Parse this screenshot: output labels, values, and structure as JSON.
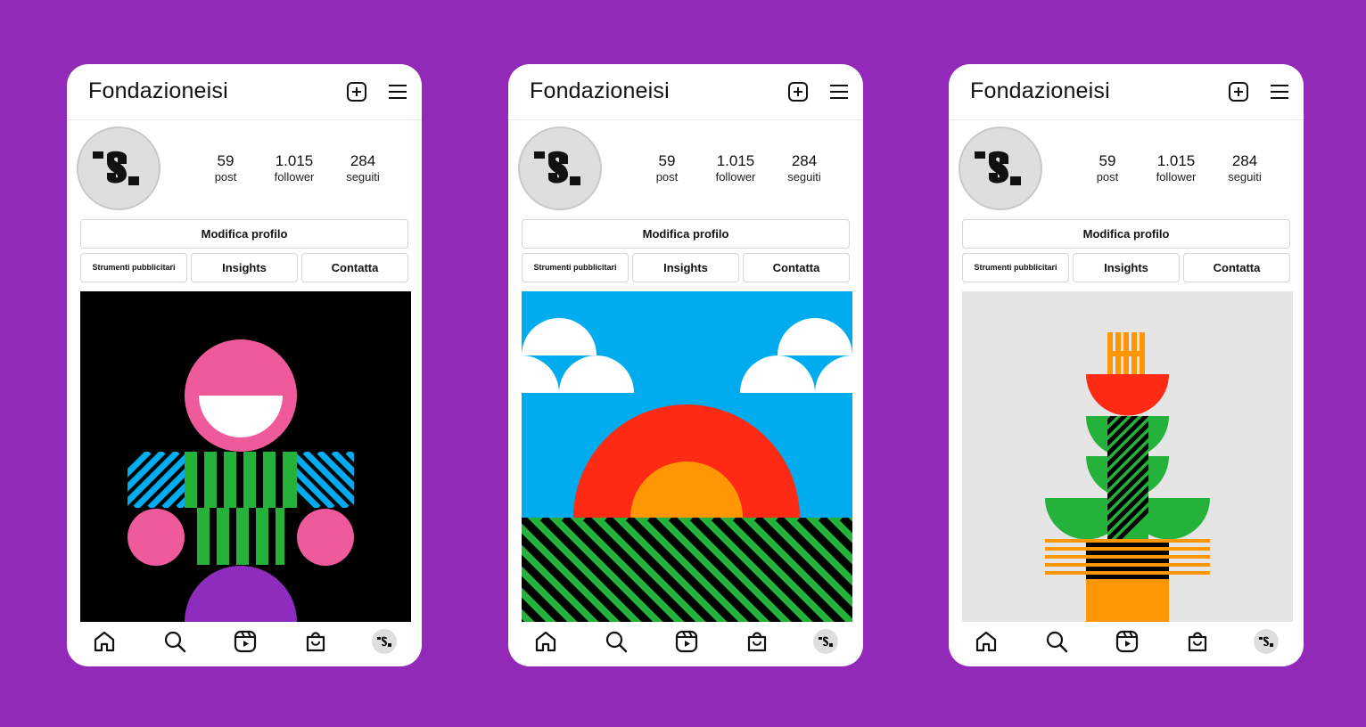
{
  "background_color": "#9229b8",
  "phones": [
    {
      "username": "Fondazioneisi",
      "stats": {
        "posts": {
          "value": "59",
          "label": "post"
        },
        "followers": {
          "value": "1.015",
          "label": "follower"
        },
        "following": {
          "value": "284",
          "label": "seguiti"
        }
      },
      "buttons": {
        "edit_profile": "Modifica profilo",
        "ad_tools": "Strumenti pubblicitari",
        "insights": "Insights",
        "contact": "Contatta"
      },
      "post_artwork": "figure-black-background"
    },
    {
      "username": "Fondazioneisi",
      "stats": {
        "posts": {
          "value": "59",
          "label": "post"
        },
        "followers": {
          "value": "1.015",
          "label": "follower"
        },
        "following": {
          "value": "284",
          "label": "seguiti"
        }
      },
      "buttons": {
        "edit_profile": "Modifica profilo",
        "ad_tools": "Strumenti pubblicitari",
        "insights": "Insights",
        "contact": "Contatta"
      },
      "post_artwork": "sunset-landscape"
    },
    {
      "username": "Fondazioneisi",
      "stats": {
        "posts": {
          "value": "59",
          "label": "post"
        },
        "followers": {
          "value": "1.015",
          "label": "follower"
        },
        "following": {
          "value": "284",
          "label": "seguiti"
        }
      },
      "buttons": {
        "edit_profile": "Modifica profilo",
        "ad_tools": "Strumenti pubblicitari",
        "insights": "Insights",
        "contact": "Contatta"
      },
      "post_artwork": "plant-in-pot"
    }
  ],
  "icons": {
    "header": [
      "plus-square-icon",
      "hamburger-menu-icon"
    ],
    "nav": [
      "home-icon",
      "search-icon",
      "reels-icon",
      "shop-bag-icon",
      "profile-avatar"
    ]
  },
  "palette": {
    "pink": "#ef5a9b",
    "green": "#25b23a",
    "blue": "#00aced",
    "red": "#ff2a14",
    "orange": "#ff9705",
    "purple": "#8e2dbd",
    "grey": "#e5e5e5"
  }
}
